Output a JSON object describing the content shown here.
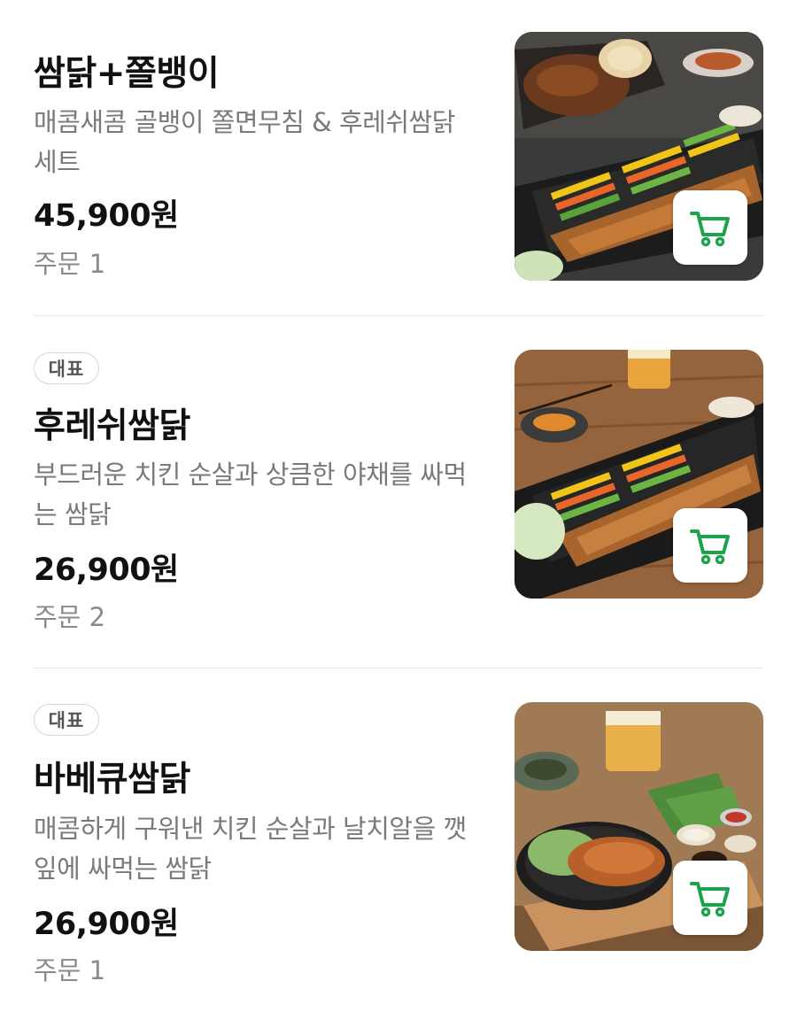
{
  "colors": {
    "accent": "#1ea24b",
    "name_text": "#111111",
    "desc_text": "#7a7a7a",
    "divider": "#e6e6e6"
  },
  "menu": {
    "items": [
      {
        "badge": "",
        "name": "쌈닭+쫄뱅이",
        "description": "매콤새콤 골뱅이 쫄면무침 & 후레쉬쌈닭 세트",
        "price": "45,900원",
        "orders": "주문 1",
        "photo_icon": "food-photo",
        "cart_icon": "shopping-cart-icon"
      },
      {
        "badge": "대표",
        "name": "후레쉬쌈닭",
        "description": "부드러운 치킨 순살과 상큼한 야채를 싸먹는 쌈닭",
        "price": "26,900원",
        "orders": "주문 2",
        "photo_icon": "food-photo",
        "cart_icon": "shopping-cart-icon"
      },
      {
        "badge": "대표",
        "name": "바베큐쌈닭",
        "description": "매콤하게 구워낸 치킨 순살과 날치알을 깻잎에 싸먹는 쌈닭",
        "price": "26,900원",
        "orders": "주문 1",
        "photo_icon": "food-photo",
        "cart_icon": "shopping-cart-icon"
      }
    ]
  }
}
